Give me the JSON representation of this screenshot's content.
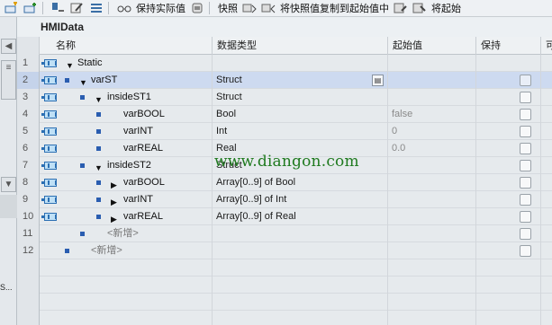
{
  "toolbar": {
    "keep_actual_label": "保持实际值",
    "snapshot_label": "快照",
    "copy_snapshot_label": "将快照值复制到起始值中",
    "truncated_label": "将起始"
  },
  "editor": {
    "title": "HMIData"
  },
  "columns": {
    "name": "名称",
    "datatype": "数据类型",
    "start_value": "起始值",
    "retain": "保持",
    "more": "可"
  },
  "rows": [
    {
      "num": "1",
      "name": "Static",
      "type": "",
      "start": ""
    },
    {
      "num": "2",
      "name": "varST",
      "type": "Struct",
      "start": ""
    },
    {
      "num": "3",
      "name": "insideST1",
      "type": "Struct",
      "start": ""
    },
    {
      "num": "4",
      "name": "varBOOL",
      "type": "Bool",
      "start": "false"
    },
    {
      "num": "5",
      "name": "varINT",
      "type": "Int",
      "start": "0"
    },
    {
      "num": "6",
      "name": "varREAL",
      "type": "Real",
      "start": "0.0"
    },
    {
      "num": "7",
      "name": "insideST2",
      "type": "Struct",
      "start": ""
    },
    {
      "num": "8",
      "name": "varBOOL",
      "type": "Array[0..9] of Bool",
      "start": ""
    },
    {
      "num": "9",
      "name": "varINT",
      "type": "Array[0..9] of Int",
      "start": ""
    },
    {
      "num": "10",
      "name": "varREAL",
      "type": "Array[0..9] of Real",
      "start": ""
    },
    {
      "num": "11",
      "name": "<新增>",
      "type": "",
      "start": ""
    },
    {
      "num": "12",
      "name": "<新增>",
      "type": "",
      "start": ""
    }
  ],
  "left_panel": {
    "fragment": "S..."
  },
  "watermark": "www.diangon.com",
  "colors": {
    "selected_row": "#cddaf0",
    "icon_blue": "#2b6fb3",
    "watermark": "#1f7a1f"
  }
}
